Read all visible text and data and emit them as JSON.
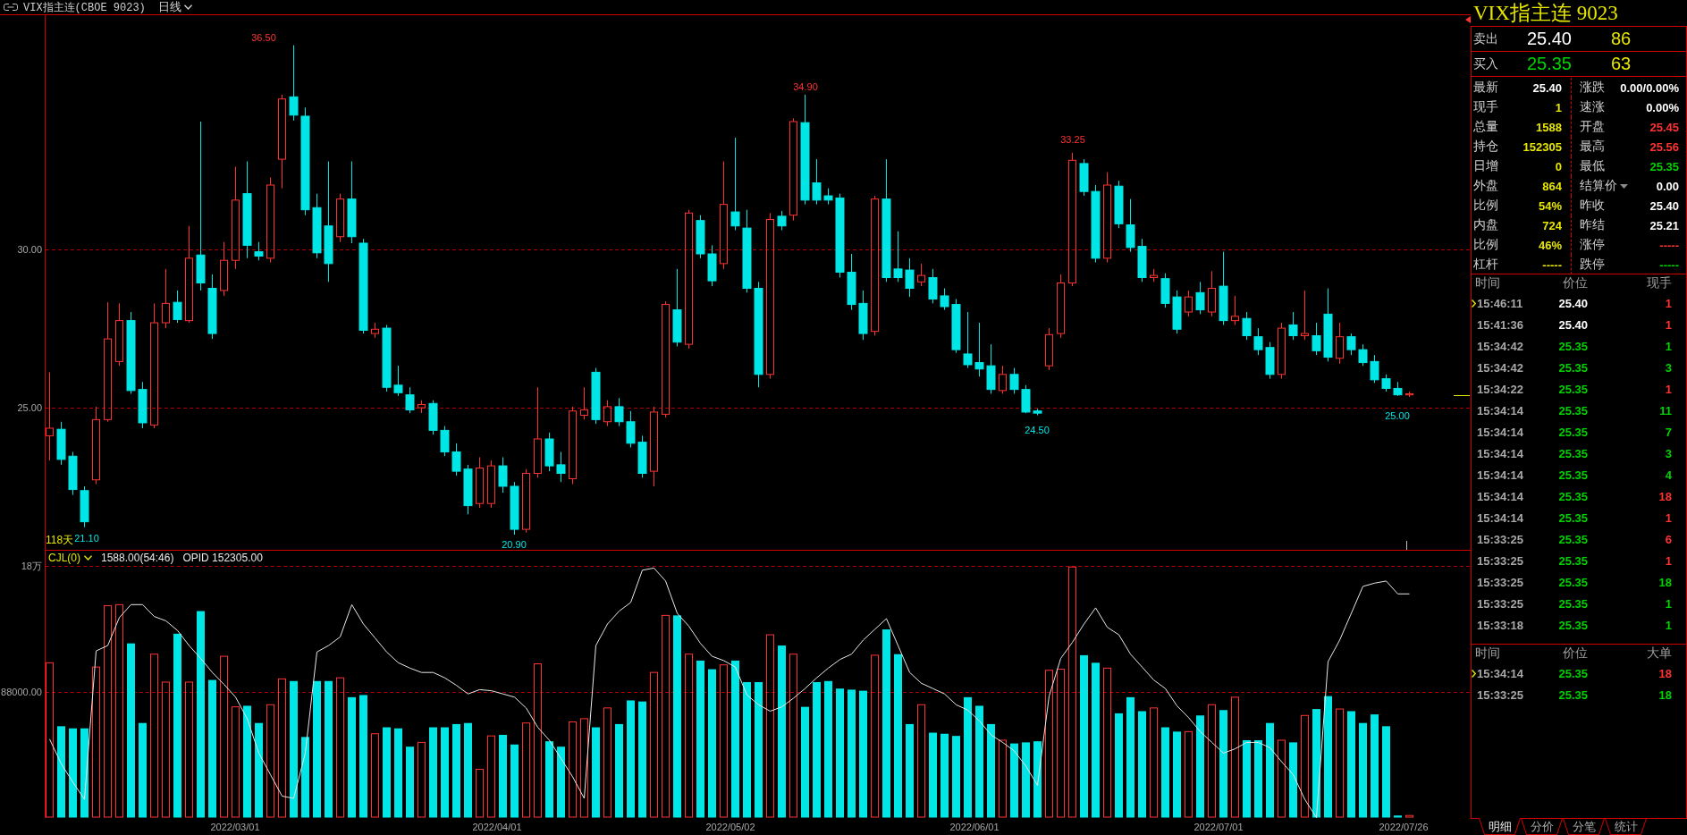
{
  "header": {
    "title": "VIX指主连(CBOE 9023)",
    "period": "日线"
  },
  "price_chart": {
    "axis_labels": [
      "30.00",
      "25.00"
    ],
    "extreme_marks": [
      {
        "kind": "low",
        "text": "21.10"
      },
      {
        "kind": "high",
        "text": "36.50"
      },
      {
        "kind": "low",
        "text": "20.90"
      },
      {
        "kind": "high",
        "text": "34.90"
      },
      {
        "kind": "low",
        "text": "24.50"
      },
      {
        "kind": "high",
        "text": "33.25"
      },
      {
        "kind": "low",
        "text": "25.00"
      }
    ],
    "span_label": "118天"
  },
  "volume_chart": {
    "indicator": "CJL(0)",
    "reading": "1588.00(54:46)",
    "opid": "OPID 152305.00",
    "axis_labels": [
      "18万",
      "88000.00"
    ]
  },
  "date_axis": [
    "2022/03/01",
    "2022/04/01",
    "2022/05/02",
    "2022/06/01",
    "2022/07/01",
    "2022/07/26"
  ],
  "quote_panel": {
    "title": "VIX指主连 9023",
    "ask": {
      "label": "卖出",
      "price": "25.40",
      "volume": "86",
      "color": "#ffffff"
    },
    "bid": {
      "label": "买入",
      "price": "25.35",
      "volume": "63",
      "color": "#00d200"
    },
    "left_fields": [
      {
        "label": "最新",
        "value": "25.40",
        "color": "#ffffff"
      },
      {
        "label": "现手",
        "value": "1",
        "color": "#e6e600"
      },
      {
        "label": "总量",
        "value": "1588",
        "color": "#e6e600"
      },
      {
        "label": "持仓",
        "value": "152305",
        "color": "#e6e600"
      },
      {
        "label": "日增",
        "value": "0",
        "color": "#e6e600"
      },
      {
        "label": "外盘",
        "value": "864",
        "color": "#e6e600"
      },
      {
        "label": "比例",
        "value": "54%",
        "color": "#e6e600"
      },
      {
        "label": "内盘",
        "value": "724",
        "color": "#e6e600"
      },
      {
        "label": "比例",
        "value": "46%",
        "color": "#e6e600"
      },
      {
        "label": "杠杆",
        "value": "-----",
        "color": "#e6e600"
      }
    ],
    "right_fields": [
      {
        "label": "涨跌",
        "value": "0.00/0.00%",
        "color": "#ffffff",
        "kind": "plain"
      },
      {
        "label": "速涨",
        "value": "0.00%",
        "color": "#ffffff",
        "kind": "plain"
      },
      {
        "label": "开盘",
        "value": "25.45",
        "color": "#ff3232",
        "kind": "plain"
      },
      {
        "label": "最高",
        "value": "25.56",
        "color": "#ff3232",
        "kind": "plain"
      },
      {
        "label": "最低",
        "value": "25.35",
        "color": "#00d200",
        "kind": "plain"
      },
      {
        "label": "结算价",
        "value": "0.00",
        "color": "#ffffff",
        "kind": "menu"
      },
      {
        "label": "昨收",
        "value": "25.40",
        "color": "#ffffff",
        "kind": "plain"
      },
      {
        "label": "昨结",
        "value": "25.21",
        "color": "#ffffff",
        "kind": "plain"
      },
      {
        "label": "涨停",
        "value": "-----",
        "color": "#ff3232",
        "kind": "plain"
      },
      {
        "label": "跌停",
        "value": "-----",
        "color": "#00d200",
        "kind": "plain"
      }
    ]
  },
  "trades": {
    "columns": [
      "时间",
      "价位",
      "现手"
    ],
    "rows": [
      {
        "time": "15:46:11",
        "price": {
          "text": "25.40",
          "color": "#ffffff"
        },
        "volume": {
          "text": "1",
          "color": "#ff3232"
        },
        "selected": true
      },
      {
        "time": "15:41:36",
        "price": {
          "text": "25.40",
          "color": "#ffffff"
        },
        "volume": {
          "text": "1",
          "color": "#ff3232"
        },
        "selected": false
      },
      {
        "time": "15:34:42",
        "price": {
          "text": "25.35",
          "color": "#00d200"
        },
        "volume": {
          "text": "1",
          "color": "#00d200"
        },
        "selected": false
      },
      {
        "time": "15:34:42",
        "price": {
          "text": "25.35",
          "color": "#00d200"
        },
        "volume": {
          "text": "3",
          "color": "#00d200"
        },
        "selected": false
      },
      {
        "time": "15:34:22",
        "price": {
          "text": "25.35",
          "color": "#00d200"
        },
        "volume": {
          "text": "1",
          "color": "#ff3232"
        },
        "selected": false
      },
      {
        "time": "15:34:14",
        "price": {
          "text": "25.35",
          "color": "#00d200"
        },
        "volume": {
          "text": "11",
          "color": "#00d200"
        },
        "selected": false
      },
      {
        "time": "15:34:14",
        "price": {
          "text": "25.35",
          "color": "#00d200"
        },
        "volume": {
          "text": "7",
          "color": "#00d200"
        },
        "selected": false
      },
      {
        "time": "15:34:14",
        "price": {
          "text": "25.35",
          "color": "#00d200"
        },
        "volume": {
          "text": "3",
          "color": "#00d200"
        },
        "selected": false
      },
      {
        "time": "15:34:14",
        "price": {
          "text": "25.35",
          "color": "#00d200"
        },
        "volume": {
          "text": "4",
          "color": "#00d200"
        },
        "selected": false
      },
      {
        "time": "15:34:14",
        "price": {
          "text": "25.35",
          "color": "#00d200"
        },
        "volume": {
          "text": "18",
          "color": "#ff3232"
        },
        "selected": false
      },
      {
        "time": "15:34:14",
        "price": {
          "text": "25.35",
          "color": "#00d200"
        },
        "volume": {
          "text": "1",
          "color": "#ff3232"
        },
        "selected": false
      },
      {
        "time": "15:33:25",
        "price": {
          "text": "25.35",
          "color": "#00d200"
        },
        "volume": {
          "text": "6",
          "color": "#ff3232"
        },
        "selected": false
      },
      {
        "time": "15:33:25",
        "price": {
          "text": "25.35",
          "color": "#00d200"
        },
        "volume": {
          "text": "1",
          "color": "#ff3232"
        },
        "selected": false
      },
      {
        "time": "15:33:25",
        "price": {
          "text": "25.35",
          "color": "#00d200"
        },
        "volume": {
          "text": "18",
          "color": "#00d200"
        },
        "selected": false
      },
      {
        "time": "15:33:25",
        "price": {
          "text": "25.35",
          "color": "#00d200"
        },
        "volume": {
          "text": "1",
          "color": "#00d200"
        },
        "selected": false
      },
      {
        "time": "15:33:18",
        "price": {
          "text": "25.35",
          "color": "#00d200"
        },
        "volume": {
          "text": "1",
          "color": "#00d200"
        },
        "selected": false
      }
    ]
  },
  "big_orders": {
    "columns": [
      "时间",
      "价位",
      "大单"
    ],
    "rows": [
      {
        "time": "15:34:14",
        "price": {
          "text": "25.35",
          "color": "#00d200"
        },
        "volume": {
          "text": "18",
          "color": "#ff3232"
        },
        "selected": true
      },
      {
        "time": "15:33:25",
        "price": {
          "text": "25.35",
          "color": "#00d200"
        },
        "volume": {
          "text": "18",
          "color": "#00d200"
        },
        "selected": false
      }
    ]
  },
  "tabs": [
    {
      "label": "明细",
      "selected": true
    },
    {
      "label": "分价",
      "selected": false
    },
    {
      "label": "分笔",
      "selected": false
    },
    {
      "label": "统计",
      "selected": false
    }
  ]
}
